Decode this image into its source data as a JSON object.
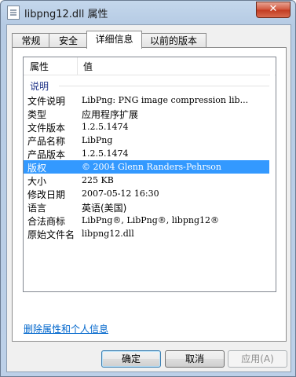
{
  "window": {
    "title": "libpng12.dll 属性",
    "close_label": "✕"
  },
  "tabs": [
    {
      "label": "常规"
    },
    {
      "label": "安全"
    },
    {
      "label": "详细信息"
    },
    {
      "label": "以前的版本"
    }
  ],
  "details": {
    "col_property": "属性",
    "col_value": "值",
    "group_label": "说明",
    "rows": [
      {
        "name": "文件说明",
        "value": "LibPng: PNG image compression lib..."
      },
      {
        "name": "类型",
        "value": "应用程序扩展"
      },
      {
        "name": "文件版本",
        "value": "1.2.5.1474"
      },
      {
        "name": "产品名称",
        "value": "LibPng"
      },
      {
        "name": "产品版本",
        "value": "1.2.5.1474"
      },
      {
        "name": "版权",
        "value": "© 2004 Glenn Randers-Pehrson"
      },
      {
        "name": "大小",
        "value": "225 KB"
      },
      {
        "name": "修改日期",
        "value": "2007-05-12 16:30"
      },
      {
        "name": "语言",
        "value": "英语(美国)"
      },
      {
        "name": "合法商标",
        "value": "LibPng®, LibPng®, libpng12®"
      },
      {
        "name": "原始文件名",
        "value": "libpng12.dll"
      }
    ]
  },
  "remove_link": "删除属性和个人信息",
  "buttons": {
    "ok": "确定",
    "cancel": "取消",
    "apply": "应用(A)"
  }
}
